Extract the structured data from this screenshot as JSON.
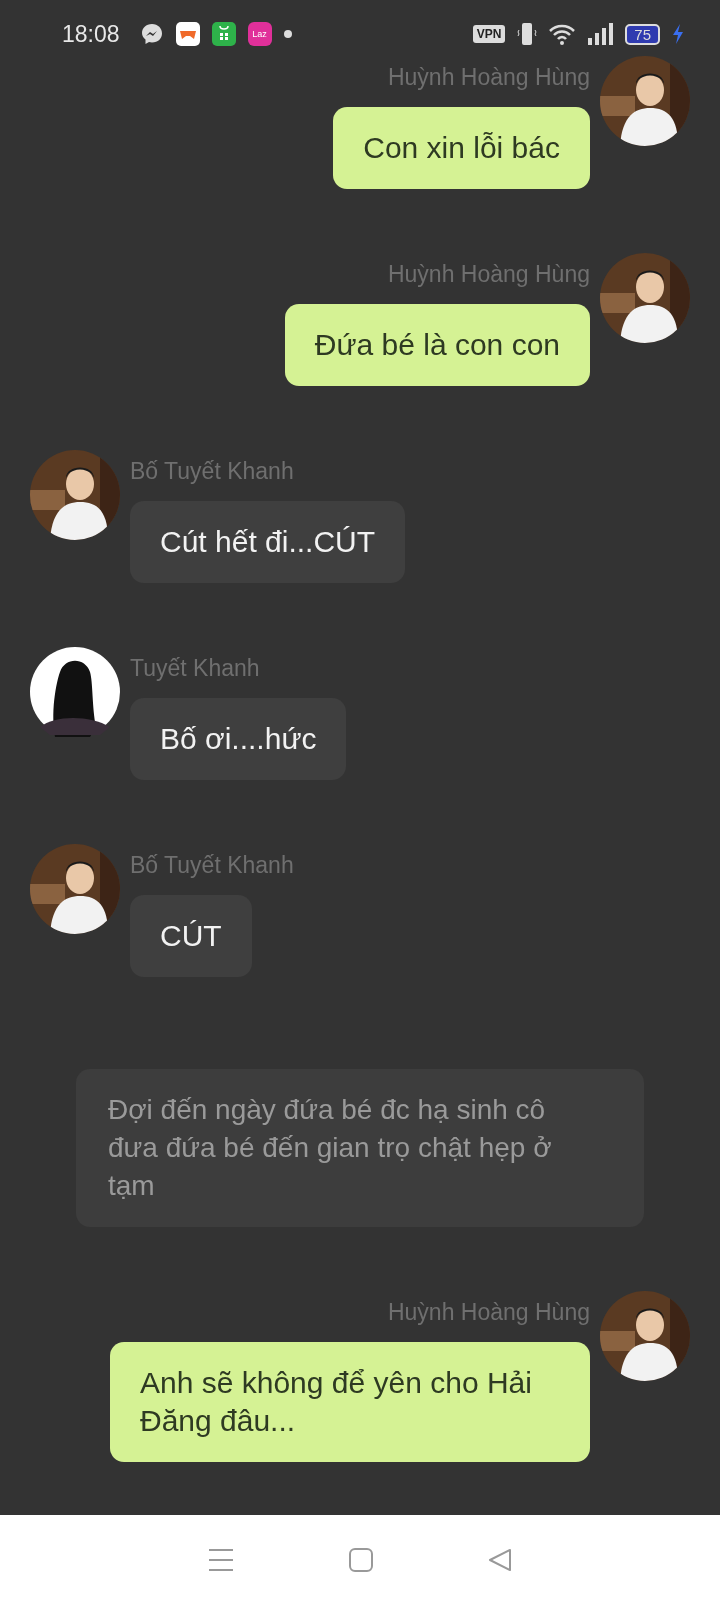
{
  "status_bar": {
    "time": "18:08",
    "notifications": [
      {
        "kind": "messenger"
      },
      {
        "kind": "game"
      },
      {
        "kind": "shop"
      },
      {
        "kind": "laz",
        "label": "Laz"
      },
      {
        "kind": "dot"
      }
    ],
    "vpn": "VPN",
    "battery": "75",
    "charging": true
  },
  "messages": [
    {
      "kind": "outgoing",
      "sender": "Huỳnh Hoàng Hùng",
      "text": "Con xin lỗi bác"
    },
    {
      "kind": "outgoing",
      "sender": "Huỳnh Hoàng Hùng",
      "text": "Đứa bé là con con"
    },
    {
      "kind": "incoming",
      "sender": "Bố Tuyết Khanh",
      "text": "Cút hết đi...CÚT"
    },
    {
      "kind": "incoming",
      "sender": "Tuyết Khanh",
      "avatar": {
        "kind": "silhouette"
      },
      "text": "Bố ơi....hức"
    },
    {
      "kind": "incoming",
      "sender": "Bố Tuyết Khanh",
      "text": "CÚT"
    },
    {
      "kind": "narration",
      "text": "Đợi đến ngày đứa bé đc hạ sinh cô đưa đứa bé đến gian trọ chật hẹp ở tạm"
    },
    {
      "kind": "outgoing",
      "sender": "Huỳnh Hoàng Hùng",
      "text": "Anh sẽ không để yên cho Hải Đăng đâu..."
    }
  ],
  "nav_bar": [
    {
      "kind": "menu"
    },
    {
      "kind": "home"
    },
    {
      "kind": "back"
    }
  ]
}
